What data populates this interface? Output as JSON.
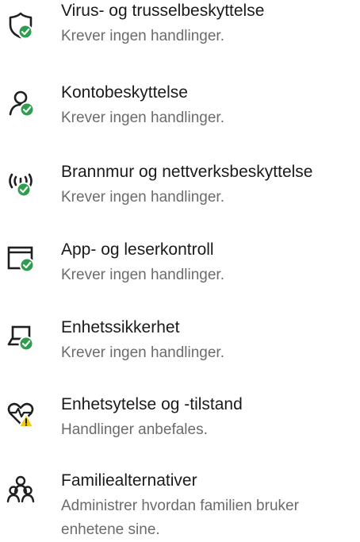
{
  "colors": {
    "ok_badge": "#2e9d4e",
    "warn_badge": "#f2c811",
    "icon_stroke": "#1f1f1f",
    "title_text": "#1a1a1a",
    "status_text": "#6b6b6b"
  },
  "items": [
    {
      "icon": "shield-icon",
      "badge": "checkmark",
      "title": "Virus- og trusselbeskyttelse",
      "status": "Krever ingen handlinger."
    },
    {
      "icon": "person-icon",
      "badge": "checkmark",
      "title": "Kontobeskyttelse",
      "status": "Krever ingen handlinger."
    },
    {
      "icon": "wireless-antenna-icon",
      "badge": "checkmark",
      "title": "Brannmur og nettverksbeskyttelse",
      "status": "Krever ingen handlinger."
    },
    {
      "icon": "browser-window-icon",
      "badge": "checkmark",
      "title": "App- og leserkontroll",
      "status": "Krever ingen handlinger."
    },
    {
      "icon": "laptop-icon",
      "badge": "checkmark",
      "title": "Enhetssikkerhet",
      "status": "Krever ingen handlinger."
    },
    {
      "icon": "heart-icon",
      "badge": "warning",
      "title": "Enhetsytelse og -tilstand",
      "status": "Handlinger anbefales."
    },
    {
      "icon": "family-icon",
      "badge": "none",
      "title": "Familiealternativer",
      "status": "Administrer hvordan familien bruker enhetene sine."
    }
  ]
}
